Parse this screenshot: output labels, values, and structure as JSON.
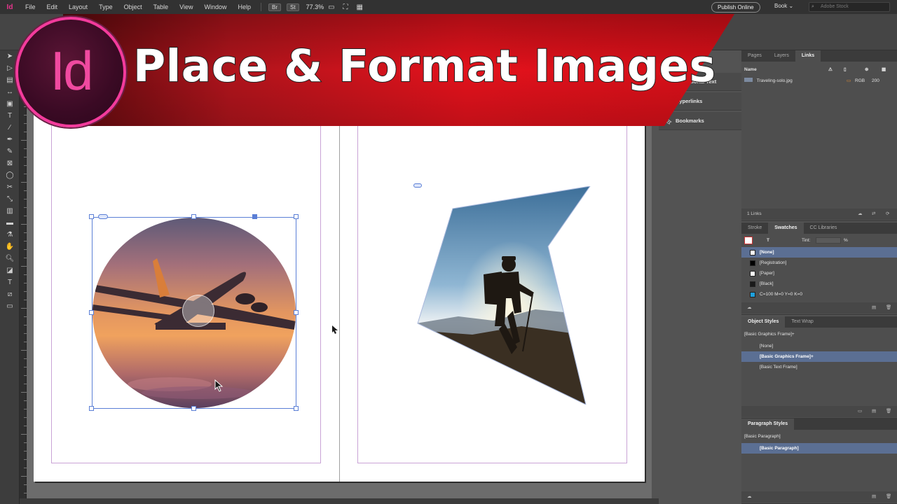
{
  "banner": {
    "title": "Place & Format Images",
    "logo_text": "Id"
  },
  "menubar": {
    "app_badge": "Id",
    "menus": [
      "File",
      "Edit",
      "Layout",
      "Type",
      "Object",
      "Table",
      "View",
      "Window",
      "Help"
    ],
    "bridge_label": "Br",
    "stock_label": "St",
    "zoom": "77.3%",
    "publish_label": "Publish Online",
    "workspace_label": "Book",
    "search_placeholder": "Adobe Stock"
  },
  "mid_panel": {
    "items": [
      "Conditional Text",
      "Hyperlinks",
      "Bookmarks"
    ]
  },
  "links_panel": {
    "tabs": [
      "Pages",
      "Layers",
      "Links"
    ],
    "header_name": "Name",
    "file_name": "Traveling-solo.jpg",
    "color_space": "RGB",
    "ppi": "200",
    "count": "1 Links"
  },
  "swatches_panel": {
    "tabs": [
      "Stroke",
      "Swatches",
      "CC Libraries"
    ],
    "tint_label": "Tint:",
    "tint_unit": "%",
    "items": [
      {
        "label": "[None]",
        "color": "#ffffff"
      },
      {
        "label": "[Registration]",
        "color": "#000000"
      },
      {
        "label": "[Paper]",
        "color": "#ffffff"
      },
      {
        "label": "[Black]",
        "color": "#1a1a1a"
      },
      {
        "label": "C=100 M=0 Y=0 K=0",
        "color": "#1ea0dc"
      }
    ]
  },
  "object_styles_panel": {
    "tabs": [
      "Object Styles",
      "Text Wrap"
    ],
    "current": "[Basic Graphics Frame]+",
    "items": [
      "[None]",
      "[Basic Graphics Frame]+",
      "[Basic Text Frame]"
    ]
  },
  "paragraph_styles_panel": {
    "tabs": [
      "Paragraph Styles"
    ],
    "current": "[Basic Paragraph]",
    "items": [
      "[Basic Paragraph]"
    ]
  },
  "colors": {
    "banner_red": "#e3121c",
    "banner_dark": "#6a0f12",
    "logo_pink": "#f33b9c",
    "selection_blue": "#5b7fd6"
  }
}
